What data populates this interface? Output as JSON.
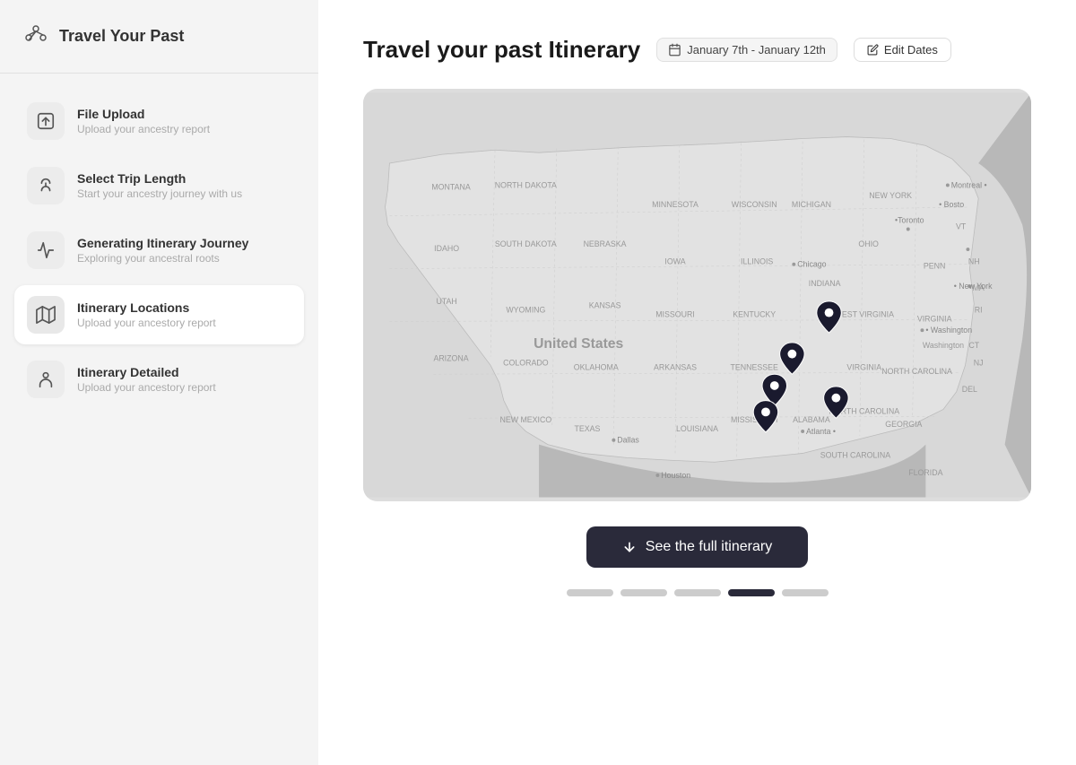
{
  "sidebar": {
    "title": "Travel Your Past",
    "steps": [
      {
        "id": "file-upload",
        "label": "File Upload",
        "sublabel": "Upload your ancestry report",
        "active": false,
        "icon": "upload"
      },
      {
        "id": "select-trip",
        "label": "Select Trip Length",
        "sublabel": "Start your ancestry journey with us",
        "active": false,
        "icon": "palm"
      },
      {
        "id": "generating",
        "label": "Generating Itinerary Journey",
        "sublabel": "Exploring your ancestral roots",
        "active": false,
        "icon": "route"
      },
      {
        "id": "locations",
        "label": "Itinerary Locations",
        "sublabel": "Upload your ancestory report",
        "active": true,
        "icon": "map"
      },
      {
        "id": "detailed",
        "label": "Itinerary Detailed",
        "sublabel": "Upload your ancestory report",
        "active": false,
        "icon": "person-pin"
      }
    ]
  },
  "main": {
    "title": "Travel your past Itinerary",
    "date_range": "January 7th - January 12th",
    "edit_dates_label": "Edit Dates",
    "itinerary_btn_label": "See the full itinerary",
    "pagination": {
      "total": 5,
      "active_index": 3
    },
    "map_pins": [
      {
        "id": "pin1",
        "left_pct": 54.8,
        "top_pct": 38
      },
      {
        "id": "pin2",
        "left_pct": 50.8,
        "top_pct": 50
      },
      {
        "id": "pin3",
        "left_pct": 48.5,
        "top_pct": 58
      },
      {
        "id": "pin4",
        "left_pct": 47.5,
        "top_pct": 68
      },
      {
        "id": "pin5",
        "left_pct": 56.0,
        "top_pct": 62
      }
    ]
  },
  "colors": {
    "sidebar_bg": "#f4f4f4",
    "main_bg": "#ffffff",
    "active_step_bg": "#ffffff",
    "button_bg": "#2a2a3a",
    "dot_active": "#2a2a3a",
    "dot_inactive": "#cccccc"
  }
}
